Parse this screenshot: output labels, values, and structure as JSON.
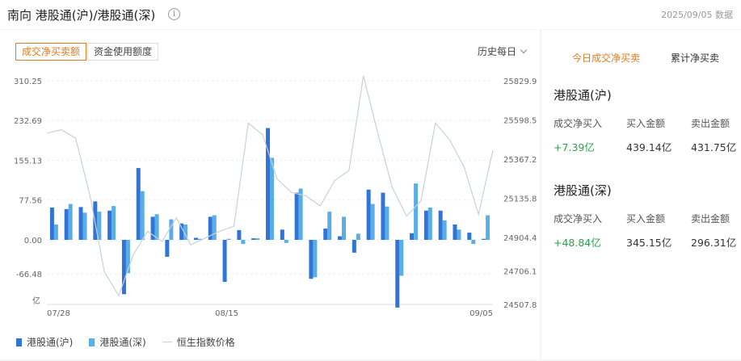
{
  "header": {
    "title": "南向 港股通(沪)/港股通(深)",
    "info_icon": "info-circle-icon",
    "date": "2025/09/05 数据"
  },
  "tabs": {
    "net_buy_label": "成交净买卖额",
    "fund_usage_label": "资金使用额度",
    "period_label": "历史每日"
  },
  "legend": {
    "hgt": "港股通(沪)",
    "sgt": "港股通(深)",
    "hsi": "恒生指数价格"
  },
  "colors": {
    "hgt": "#2f74d6",
    "sgt": "#5aaee8",
    "hsi": "#c9d1d8",
    "accent": "#e07a1f",
    "positive": "#2aa048"
  },
  "chart_data": {
    "type": "bar",
    "left_axis": {
      "unit": "亿",
      "ticks": [
        "310.25",
        "232.69",
        "155.13",
        "77.56",
        "0.00",
        "-66.48"
      ],
      "range": [
        -126,
        310.25
      ]
    },
    "right_axis": {
      "ticks": [
        "25829.9",
        "25598.5",
        "25367.2",
        "25135.8",
        "24904.4",
        "24706.1",
        "24507.8"
      ],
      "range": [
        24507.8,
        25829.9
      ]
    },
    "x_tick_labels": [
      "07/28",
      "08/15",
      "09/05"
    ],
    "x_tick_positions": [
      0,
      12,
      28
    ],
    "series": [
      {
        "name": "港股通(沪)",
        "values": [
          63,
          60,
          64,
          75,
          57,
          -106,
          140,
          45,
          -33,
          32,
          4,
          45,
          -82,
          19,
          3,
          218,
          20,
          92,
          -76,
          22,
          7,
          -25,
          98,
          92,
          -132,
          13,
          57,
          57,
          30,
          14,
          2
        ]
      },
      {
        "name": "港股通(深)",
        "values": [
          30,
          70,
          53,
          55,
          66,
          -65,
          95,
          50,
          40,
          30,
          2,
          48,
          2,
          -8,
          3,
          160,
          -6,
          100,
          -73,
          55,
          45,
          12,
          70,
          65,
          -70,
          110,
          63,
          38,
          20,
          -8,
          48
        ]
      },
      {
        "name": "恒生指数价格",
        "values": [
          25520,
          25540,
          25490,
          25150,
          24700,
          24560,
          24800,
          24940,
          24880,
          25020,
          24860,
          24900,
          24940,
          24970,
          25580,
          25510,
          25250,
          25170,
          25150,
          25090,
          25240,
          25300,
          25860,
          25520,
          25200,
          25030,
          25120,
          25580,
          25480,
          25320,
          25040,
          25420
        ]
      }
    ]
  },
  "right_panel": {
    "tab_today": "今日成交净买卖",
    "tab_cumulative": "累计净买卖",
    "hgt": {
      "title": "港股通(沪)",
      "net_label": "成交净买入",
      "buy_label": "买入金额",
      "sell_label": "卖出金额",
      "net": "+7.39亿",
      "buy": "439.14亿",
      "sell": "431.75亿"
    },
    "sgt": {
      "title": "港股通(深)",
      "net_label": "成交净买入",
      "buy_label": "买入金额",
      "sell_label": "卖出金额",
      "net": "+48.84亿",
      "buy": "345.15亿",
      "sell": "296.31亿"
    }
  }
}
